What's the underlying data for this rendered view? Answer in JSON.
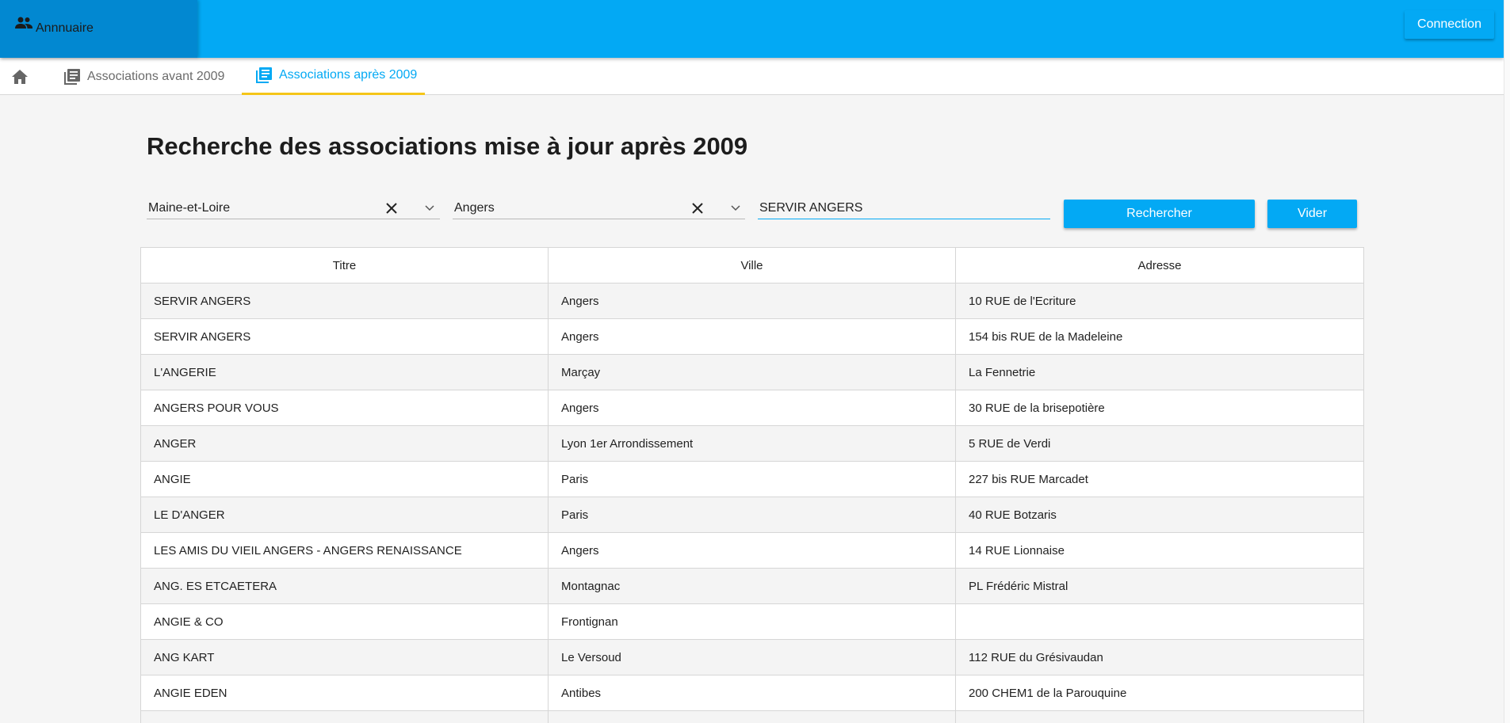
{
  "header": {
    "brand_label": "Annnuaire",
    "connect_label": "Connection",
    "accent_color": "#03a9f4",
    "brand_color": "#0288d1"
  },
  "tabs": {
    "home_icon": "home-icon",
    "before_label": "Associations avant 2009",
    "after_label": "Associations après 2009",
    "active_indicator_color": "#f5c518"
  },
  "page": {
    "title": "Recherche des associations mise à jour après 2009"
  },
  "filters": {
    "department": "Maine-et-Loire",
    "city": "Angers",
    "query": "SERVIR ANGERS",
    "search_label": "Rechercher",
    "clear_label": "Vider"
  },
  "table": {
    "headers": [
      "Titre",
      "Ville",
      "Adresse"
    ],
    "rows": [
      [
        "SERVIR ANGERS",
        "Angers",
        "10 RUE de l'Ecriture"
      ],
      [
        "SERVIR ANGERS",
        "Angers",
        "154 bis RUE de la Madeleine"
      ],
      [
        "L'ANGERIE",
        "Marçay",
        "La Fennetrie"
      ],
      [
        "ANGERS POUR VOUS",
        "Angers",
        "30 RUE de la brisepotière"
      ],
      [
        "ANGER",
        "Lyon 1er Arrondissement",
        "5 RUE de Verdi"
      ],
      [
        "ANGIE",
        "Paris",
        "227 bis RUE Marcadet"
      ],
      [
        "LE D'ANGER",
        "Paris",
        "40 RUE Botzaris"
      ],
      [
        "LES AMIS DU VIEIL ANGERS - ANGERS RENAISSANCE",
        "Angers",
        "14 RUE Lionnaise"
      ],
      [
        "ANG. ES ETCAETERA",
        "Montagnac",
        "PL Frédéric Mistral"
      ],
      [
        "ANGIE & CO",
        "Frontignan",
        ""
      ],
      [
        "ANG KART",
        "Le Versoud",
        "112 RUE du Grésivaudan"
      ],
      [
        "ANGIE EDEN",
        "Antibes",
        "200 CHEM1 de la Parouquine"
      ],
      [
        "",
        "",
        ""
      ]
    ]
  }
}
